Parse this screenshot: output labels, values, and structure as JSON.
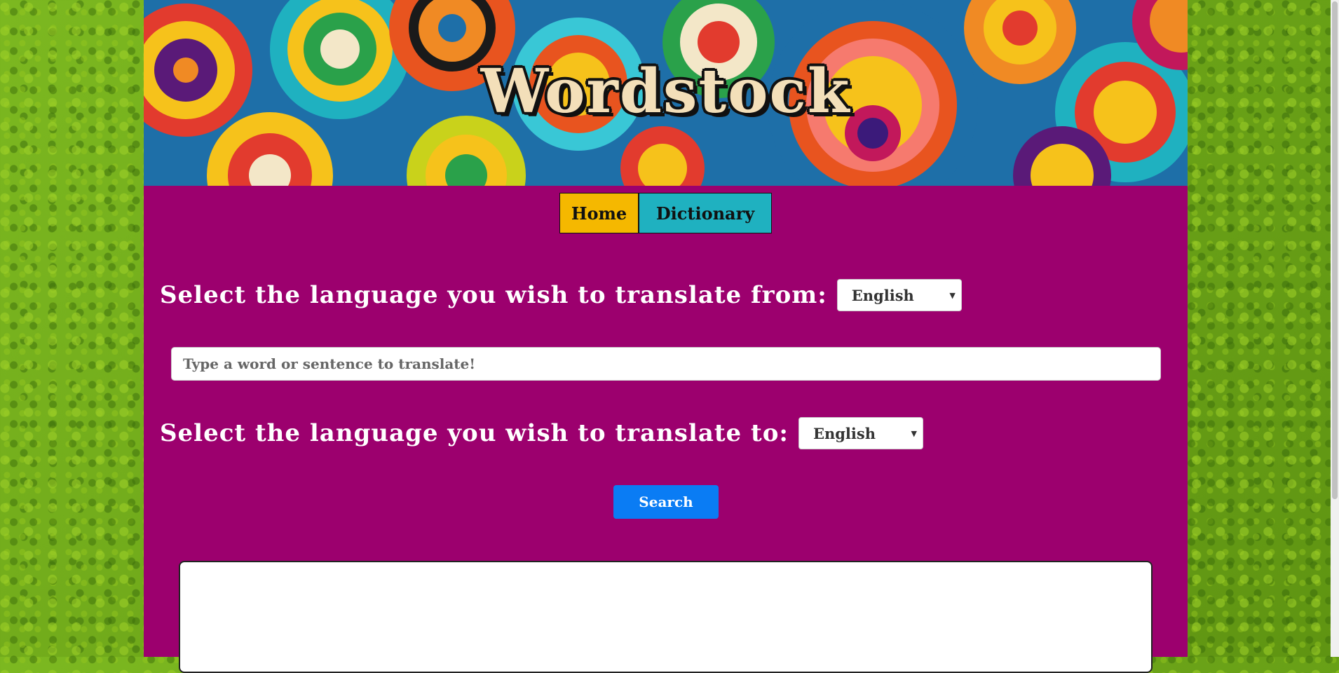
{
  "site": {
    "title": "Wordstock"
  },
  "nav": {
    "home_label": "Home",
    "dictionary_label": "Dictionary"
  },
  "translate": {
    "from_label": "Select the language you wish to translate from:",
    "from_value": "English",
    "input_placeholder": "Type a word or sentence to translate!",
    "input_value": "",
    "to_label": "Select the language you wish to translate to:",
    "to_value": "English",
    "search_label": "Search",
    "result_text": ""
  },
  "colors": {
    "page_background": "#9c006e",
    "home_tab": "#f5b800",
    "dictionary_tab": "#1fb1c0",
    "search_button": "#0a7cf4",
    "title_text": "#f3dfb9"
  },
  "icons": {
    "select_caret": "caret-down-icon"
  }
}
